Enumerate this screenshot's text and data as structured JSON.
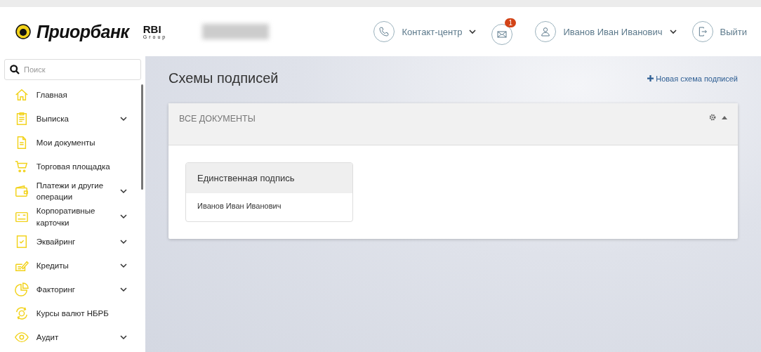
{
  "header": {
    "logo": {
      "bank_name": "Приорбанк",
      "group_mark": "RBI",
      "group_word": "Group"
    },
    "contact": {
      "label": "Контакт-центр"
    },
    "messages": {
      "badge": "1"
    },
    "user": {
      "name": "Иванов Иван Иванович"
    },
    "logout": {
      "label": "Выйти"
    }
  },
  "sidebar": {
    "search": {
      "placeholder": "Поиск"
    },
    "items": [
      {
        "label": "Главная",
        "has_submenu": false
      },
      {
        "label": "Выписка",
        "has_submenu": true
      },
      {
        "label": "Мои документы",
        "has_submenu": false
      },
      {
        "label": "Торговая площадка",
        "has_submenu": false
      },
      {
        "label": "Платежи и другие операции",
        "has_submenu": true
      },
      {
        "label": "Корпоративные карточки",
        "has_submenu": true
      },
      {
        "label": "Эквайринг",
        "has_submenu": true
      },
      {
        "label": "Кредиты",
        "has_submenu": true
      },
      {
        "label": "Факторинг",
        "has_submenu": true
      },
      {
        "label": "Курсы валют НБРБ",
        "has_submenu": false
      },
      {
        "label": "Аудит",
        "has_submenu": true
      }
    ]
  },
  "page": {
    "title": "Схемы подписей",
    "new_link": "Новая схема подписей",
    "panel": {
      "title": "ВСЕ ДОКУМЕНТЫ",
      "expanded": true,
      "schemes": [
        {
          "title": "Единственная подпись",
          "signers": [
            "Иванов Иван Иванович"
          ]
        }
      ]
    }
  }
}
